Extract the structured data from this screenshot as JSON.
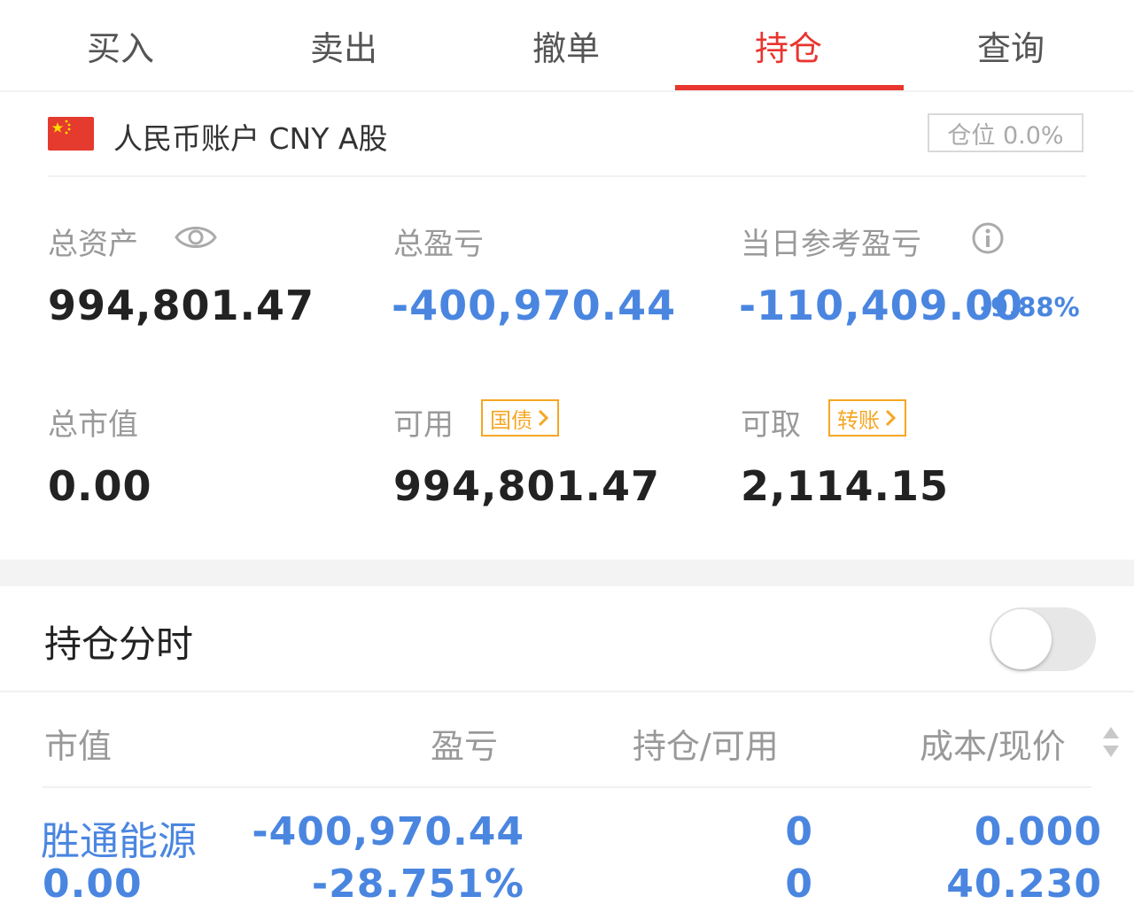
{
  "tabs": [
    {
      "label": "买入"
    },
    {
      "label": "卖出"
    },
    {
      "label": "撤单"
    },
    {
      "label": "持仓"
    },
    {
      "label": "查询"
    }
  ],
  "active_tab": "持仓",
  "account": {
    "title": "人民币账户 CNY A股",
    "position_badge": "仓位 0.0%"
  },
  "summary": {
    "total_assets_label": "总资产",
    "total_assets_value": "994,801.47",
    "total_pl_label": "总盈亏",
    "total_pl_value": "-400,970.44",
    "daily_pl_label": "当日参考盈亏",
    "daily_pl_value": "-110,409.00",
    "daily_pl_pct": "-9.88%",
    "market_value_label": "总市值",
    "market_value_value": "0.00",
    "available_label": "可用",
    "available_tag": "国债",
    "available_value": "994,801.47",
    "withdrawable_label": "可取",
    "withdrawable_tag": "转账",
    "withdrawable_value": "2,114.15"
  },
  "holdings_section": {
    "title": "持仓分时",
    "toggle_on": false
  },
  "table": {
    "headers": [
      "市值",
      "盈亏",
      "持仓/可用",
      "成本/现价"
    ],
    "rows": [
      {
        "name": "胜通能源",
        "market_value": "0.00",
        "pl": "-400,970.44",
        "pl_pct": "-28.751%",
        "position": "0",
        "available": "0",
        "cost": "0.000",
        "price": "40.230"
      }
    ]
  },
  "colors": {
    "accent_red": "#e8352f",
    "loss_blue": "#4a86e0",
    "tag_orange": "#f5a623"
  }
}
